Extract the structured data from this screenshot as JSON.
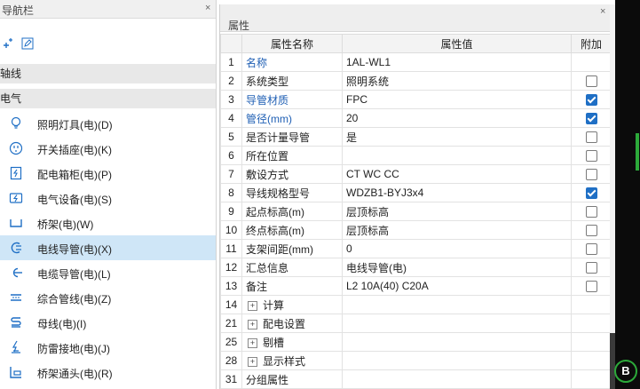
{
  "nav": {
    "title": "导航栏",
    "close": "×",
    "categories": [
      "轴线",
      "电气"
    ],
    "items": [
      {
        "label": "照明灯具(电)(D)",
        "icon": "bulb-icon"
      },
      {
        "label": "开关插座(电)(K)",
        "icon": "socket-icon"
      },
      {
        "label": "配电箱柜(电)(P)",
        "icon": "distribution-box-icon"
      },
      {
        "label": "电气设备(电)(S)",
        "icon": "electrical-equipment-icon"
      },
      {
        "label": "桥架(电)(W)",
        "icon": "cable-tray-icon"
      },
      {
        "label": "电线导管(电)(X)",
        "icon": "wire-conduit-icon"
      },
      {
        "label": "电缆导管(电)(L)",
        "icon": "cable-conduit-icon"
      },
      {
        "label": "综合管线(电)(Z)",
        "icon": "combined-pipeline-icon"
      },
      {
        "label": "母线(电)(I)",
        "icon": "busbar-icon"
      },
      {
        "label": "防雷接地(电)(J)",
        "icon": "lightning-ground-icon"
      },
      {
        "label": "桥架通头(电)(R)",
        "icon": "tray-fitting-icon"
      }
    ],
    "selected_index": 5
  },
  "props": {
    "title": "属性",
    "close": "×",
    "columns": [
      "",
      "属性名称",
      "属性值",
      "附加"
    ],
    "rows": [
      {
        "num": "1",
        "name": "名称",
        "value": "1AL-WL1",
        "blue": true,
        "checkbox": null
      },
      {
        "num": "2",
        "name": "系统类型",
        "value": "照明系统",
        "blue": false,
        "checkbox": false
      },
      {
        "num": "3",
        "name": "导管材质",
        "value": "FPC",
        "blue": true,
        "checkbox": true
      },
      {
        "num": "4",
        "name": "管径(mm)",
        "value": "20",
        "blue": true,
        "checkbox": true
      },
      {
        "num": "5",
        "name": "是否计量导管",
        "value": "是",
        "blue": false,
        "checkbox": false
      },
      {
        "num": "6",
        "name": "所在位置",
        "value": "",
        "blue": false,
        "checkbox": false
      },
      {
        "num": "7",
        "name": "敷设方式",
        "value": "CT WC CC",
        "blue": false,
        "checkbox": false
      },
      {
        "num": "8",
        "name": "导线规格型号",
        "value": "WDZB1-BYJ3x4",
        "blue": false,
        "checkbox": true
      },
      {
        "num": "9",
        "name": "起点标高(m)",
        "value": "层顶标高",
        "blue": false,
        "checkbox": false
      },
      {
        "num": "10",
        "name": "终点标高(m)",
        "value": "层顶标高",
        "blue": false,
        "checkbox": false
      },
      {
        "num": "11",
        "name": "支架间距(mm)",
        "value": "0",
        "blue": false,
        "checkbox": false
      },
      {
        "num": "12",
        "name": "汇总信息",
        "value": "电线导管(电)",
        "blue": false,
        "checkbox": false
      },
      {
        "num": "13",
        "name": "备注",
        "value": "L2 10A(40) C20A",
        "blue": false,
        "checkbox": false
      }
    ],
    "groups": [
      {
        "num": "14",
        "name": "计算",
        "expander": "+"
      },
      {
        "num": "21",
        "name": "配电设置",
        "expander": "+"
      },
      {
        "num": "25",
        "name": "剔槽",
        "expander": "+"
      },
      {
        "num": "28",
        "name": "显示样式",
        "expander": "+"
      },
      {
        "num": "31",
        "name": "分组属性",
        "expander": ""
      }
    ]
  },
  "side": {
    "b_button": "B"
  }
}
